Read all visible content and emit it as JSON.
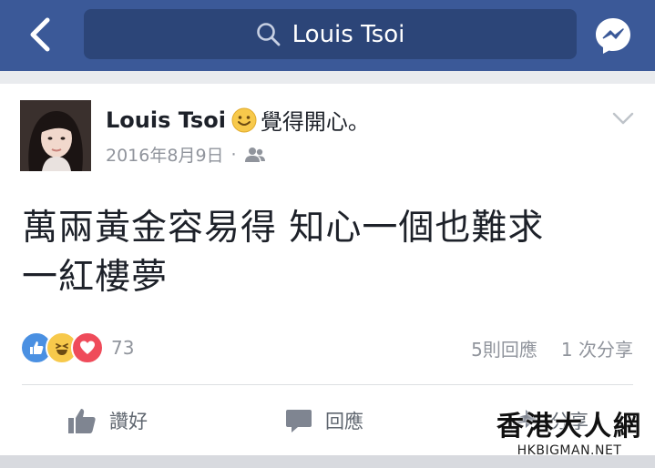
{
  "search": {
    "query": "Louis Tsoi"
  },
  "post": {
    "author": "Louis Tsoi",
    "feeling": "覺得開心。",
    "date": "2016年8月9日",
    "meta_dot": "·",
    "text_line1": "萬兩黃金容易得 知心一個也難求",
    "text_line2": "一紅樓夢",
    "reaction_count": "73",
    "comments": "5則回應",
    "shares": "1 次分享"
  },
  "actions": {
    "like": "讚好",
    "comment": "回應",
    "share": "分享"
  },
  "watermark": {
    "chinese": "香港大人網",
    "domain": "HKBIGMAN.NET"
  },
  "colors": {
    "nav": "#3b5998",
    "like_blue": "#4a90e2",
    "love_red": "#ef4b5a",
    "haha_yellow": "#f7c94b"
  },
  "icons": [
    "back-icon",
    "search-icon",
    "messenger-icon",
    "smile-emoji-icon",
    "friends-icon",
    "chevron-down-icon",
    "like-reaction-icon",
    "haha-reaction-icon",
    "love-reaction-icon",
    "thumbs-up-icon",
    "comment-icon",
    "share-icon"
  ]
}
